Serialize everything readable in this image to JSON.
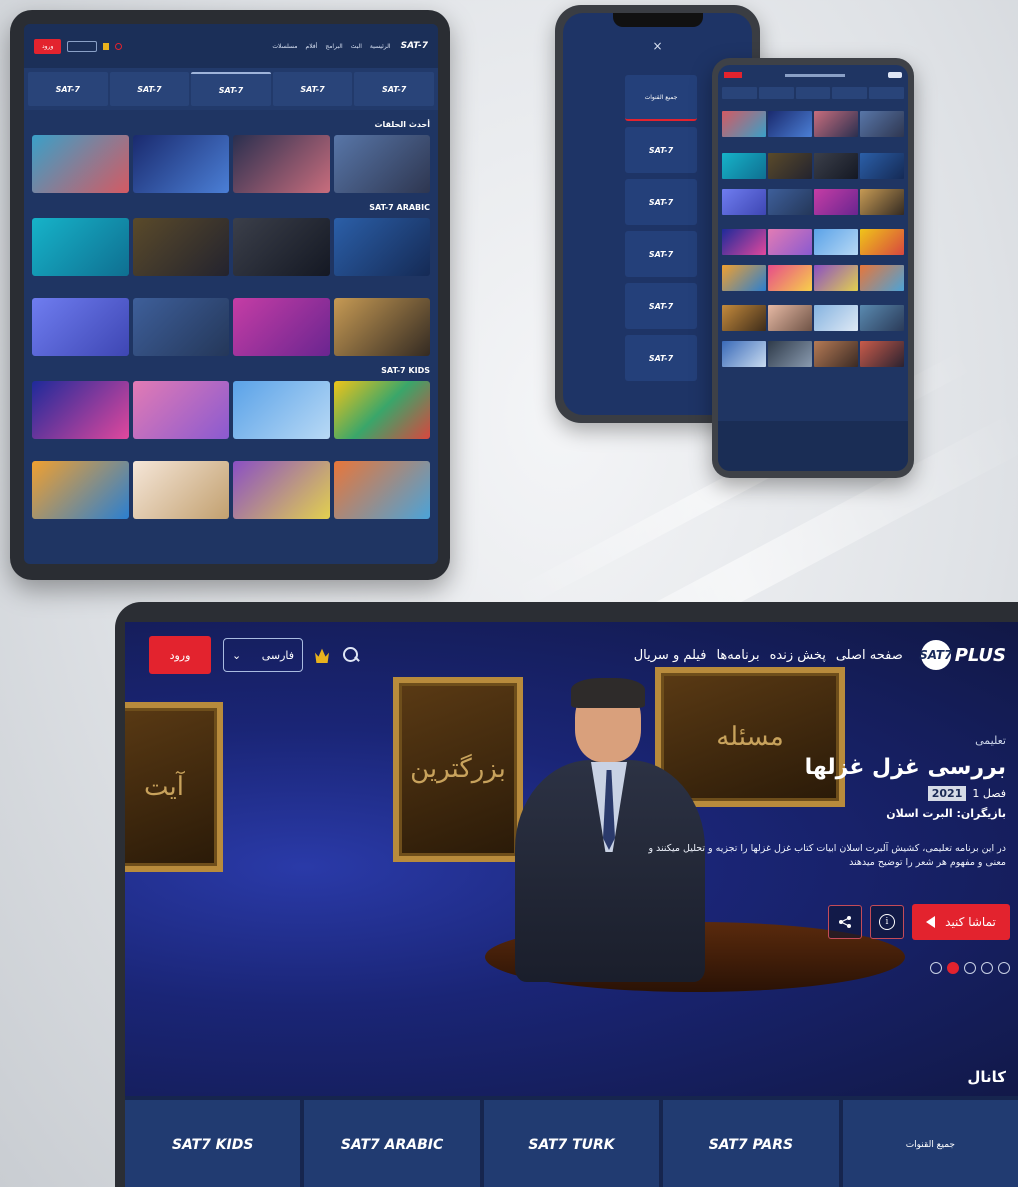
{
  "tablet": {
    "nav": {
      "login": "ورود",
      "logo": "SAT-7",
      "menu": [
        "الرئيسية",
        "البث",
        "البرامج",
        "أفلام",
        "مسلسلات"
      ]
    },
    "channels": [
      "SAT-7",
      "SAT-7",
      "SAT-7",
      "SAT-7",
      "SAT-7"
    ],
    "sections": [
      "أحدث الحلقات",
      "SAT-7 ARABIC",
      "SAT-7 KIDS"
    ]
  },
  "phone_menu": {
    "close": "×",
    "items": [
      "جميع القنوات",
      "SAT-7",
      "SAT-7",
      "SAT-7",
      "SAT-7",
      "SAT-7"
    ]
  },
  "laptop": {
    "nav": {
      "login": "ورود",
      "language": "فارسی",
      "menu": [
        "صفحه اصلی",
        "پخش زنده",
        "برنامه‌ها",
        "فیلم و سریال"
      ],
      "logo_mark": "SAT7",
      "logo_text": "PLUS"
    },
    "hero": {
      "genre": "تعلیمی",
      "title": "بررسی غزل غزلها",
      "season_label": "فصل 1",
      "year": "2021",
      "cast": "بازیگران: البرت اسلان",
      "description": "در این برنامه تعلیمی، کشیش آلبرت اسلان ابیات کتاب غزل غزلها را تجزیه و تحلیل میکنند و معنی و مفهوم هر شعر را توضیح میدهند",
      "watch_label": "تماشا کنید",
      "slides": 5,
      "active_slide": 2
    },
    "calligraphy": [
      "آیت",
      "بزرگترین",
      "مسئله"
    ],
    "channels_title": "کانال",
    "channel_tiles": [
      "SAT7 KIDS",
      "SAT7 ARABIC",
      "SAT7 TURK",
      "SAT7 PARS",
      "جميع القنوات"
    ]
  },
  "colors": {
    "brand_red": "#e3232e",
    "navy": "#1f3563"
  }
}
